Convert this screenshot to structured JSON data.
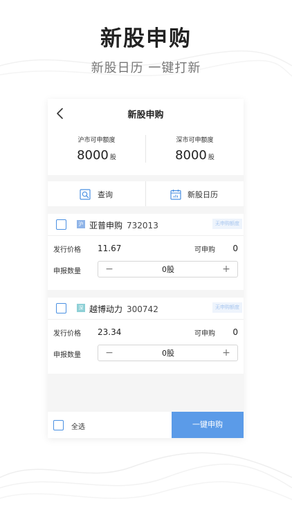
{
  "hero": {
    "title": "新股申购",
    "subtitle": "新股日历 一键打新"
  },
  "screen": {
    "nav": {
      "back_icon": "chevron-left-icon",
      "title": "新股申购"
    },
    "quota": {
      "sh": {
        "label": "沪市可申额度",
        "value": "8000",
        "unit": "股"
      },
      "sz": {
        "label": "深市可申额度",
        "value": "8000",
        "unit": "股"
      }
    },
    "actions": [
      {
        "label": "查询",
        "icon": "search-icon"
      },
      {
        "label": "新股日历",
        "icon": "calendar-icon"
      }
    ],
    "stocks": [
      {
        "checked": false,
        "market": "沪",
        "name": "亚普申购",
        "code": "732013",
        "badge": "无申购额度",
        "price_label": "发行价格",
        "price": "11.67",
        "available_label": "可申购",
        "available": "0",
        "quantity_label": "申报数量",
        "quantity": "0股",
        "minus": "−",
        "plus": "+"
      },
      {
        "checked": false,
        "market": "深",
        "name": "越博动力",
        "code": "300742",
        "badge": "无申购额度",
        "price_label": "发行价格",
        "price": "23.34",
        "available_label": "可申购",
        "available": "0",
        "quantity_label": "申报数量",
        "quantity": "0股",
        "minus": "−",
        "plus": "+"
      }
    ],
    "footer": {
      "select_all_checked": false,
      "select_all_label": "全选",
      "submit_label": "一键申购"
    }
  },
  "colors": {
    "accent": "#5b9be8",
    "checkbox_border": "#4a90e2",
    "sh_tag": "#8fb4e8",
    "sz_tag": "#8ed0d6",
    "badge_text": "#a8c6ef"
  }
}
